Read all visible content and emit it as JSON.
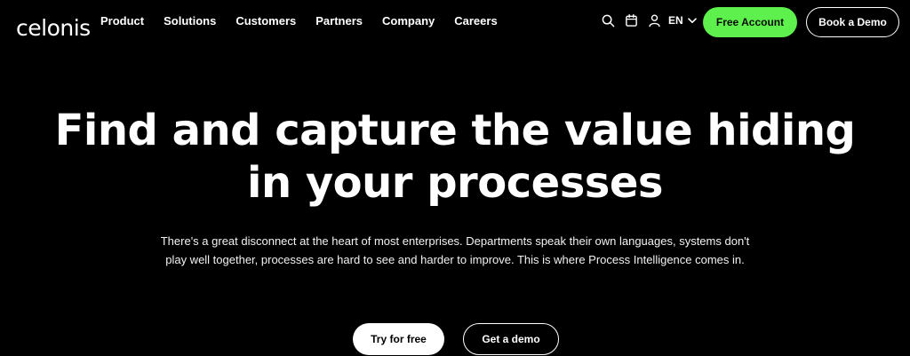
{
  "brand": {
    "logo_text": "celonis"
  },
  "nav": {
    "items": [
      {
        "label": "Product"
      },
      {
        "label": "Solutions"
      },
      {
        "label": "Customers"
      },
      {
        "label": "Partners"
      },
      {
        "label": "Company"
      },
      {
        "label": "Careers"
      }
    ],
    "icons": [
      "search-icon",
      "calendar-icon",
      "user-icon"
    ],
    "language": "EN",
    "free_account_label": "Free Account",
    "book_demo_label": "Book a Demo"
  },
  "hero": {
    "title_line1": "Find and capture the value hiding",
    "title_line2": "in your processes",
    "description": "There's a great disconnect at the heart of most enterprises. Departments speak their own languages, systems don't play well together, processes are hard to see and harder to improve. This is where Process Intelligence comes in.",
    "try_label": "Try for free",
    "demo_label": "Get a demo"
  },
  "colors": {
    "background": "#000000",
    "accent": "#5ef04c",
    "text": "#ffffff"
  }
}
